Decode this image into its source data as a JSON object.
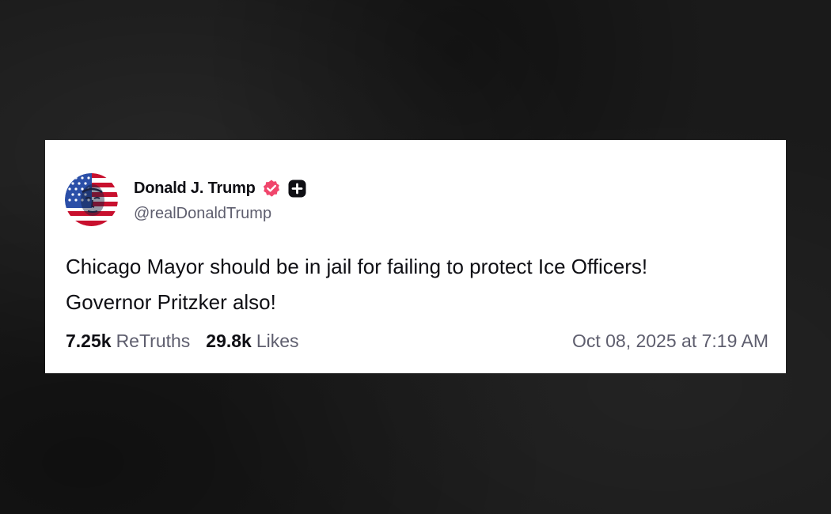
{
  "post": {
    "author": {
      "display_name": "Donald J. Trump",
      "handle": "@realDonaldTrump",
      "verified_badge_color": "#f0466c",
      "avatar_icon": "flag-portrait-avatar"
    },
    "text_lines": [
      "Chicago Mayor should be in jail for failing to protect Ice Officers!",
      "Governor Pritzker also!"
    ],
    "stats": {
      "retruths_count": "7.25k",
      "retruths_label": "ReTruths",
      "likes_count": "29.8k",
      "likes_label": "Likes"
    },
    "timestamp": "Oct 08, 2025 at 7:19 AM"
  },
  "colors": {
    "background": "#1a1a1a",
    "card": "#ffffff",
    "primary_text": "#0f0f14",
    "secondary_text": "#5e5e6e"
  }
}
